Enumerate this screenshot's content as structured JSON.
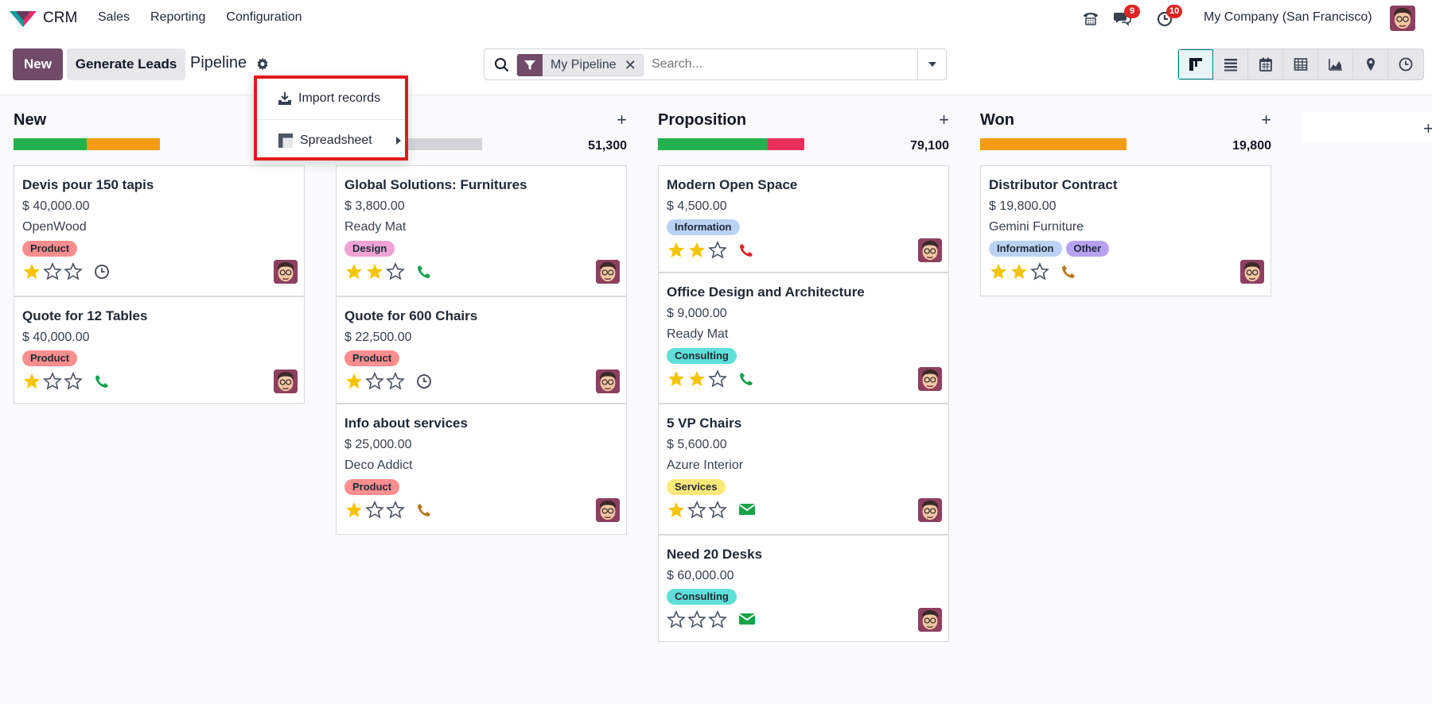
{
  "navbar": {
    "app_name": "CRM",
    "menu": [
      "Sales",
      "Reporting",
      "Configuration"
    ],
    "messages_count": "9",
    "activities_count": "10",
    "company": "My Company (San Francisco)"
  },
  "control": {
    "new_label": "New",
    "generate_label": "Generate Leads",
    "title": "Pipeline",
    "facet_label": "My Pipeline",
    "search_placeholder": "Search..."
  },
  "dropdown": {
    "import_label": "Import records",
    "spreadsheet_label": "Spreadsheet"
  },
  "columns": [
    {
      "title": "New",
      "sum": "",
      "progress": [
        {
          "color": "#22b14c",
          "pct": 0.5
        },
        {
          "color": "#f39c12",
          "pct": 0.5
        }
      ],
      "cards": [
        {
          "title": "Devis pour 150 tapis",
          "amount": "$ 40,000.00",
          "partner": "OpenWood",
          "tags": [
            {
              "label": "Product",
              "color": "#ff8e8e"
            }
          ],
          "stars": 1,
          "activity": "clock"
        },
        {
          "title": "Quote for 12 Tables",
          "amount": "$ 40,000.00",
          "partner": "",
          "tags": [
            {
              "label": "Product",
              "color": "#ff8e8e"
            }
          ],
          "stars": 1,
          "activity": "phone-green"
        }
      ]
    },
    {
      "title": "",
      "sum": "51,300",
      "progress": [
        {
          "color": "#f39c12",
          "pct": 0.15
        },
        {
          "color": "#d1d5db",
          "pct": 0.85
        }
      ],
      "cards": [
        {
          "title": "Global Solutions: Furnitures",
          "amount": "$ 3,800.00",
          "partner": "Ready Mat",
          "tags": [
            {
              "label": "Design",
              "color": "#f0a3d4"
            }
          ],
          "stars": 2,
          "activity": "phone-green"
        },
        {
          "title": "Quote for 600 Chairs",
          "amount": "$ 22,500.00",
          "partner": "",
          "tags": [
            {
              "label": "Product",
              "color": "#ff8e8e"
            }
          ],
          "stars": 1,
          "activity": "clock"
        },
        {
          "title": "Info about services",
          "amount": "$ 25,000.00",
          "partner": "Deco Addict",
          "tags": [
            {
              "label": "Product",
              "color": "#ff8e8e"
            }
          ],
          "stars": 1,
          "activity": "phone-orange"
        }
      ]
    },
    {
      "title": "Proposition",
      "sum": "79,100",
      "progress": [
        {
          "color": "#22b14c",
          "pct": 0.75
        },
        {
          "color": "#e8305a",
          "pct": 0.25
        }
      ],
      "cards": [
        {
          "title": "Modern Open Space",
          "amount": "$ 4,500.00",
          "partner": "",
          "tags": [
            {
              "label": "Information",
              "color": "#bcd2f5"
            }
          ],
          "stars": 2,
          "activity": "phone-red"
        },
        {
          "title": "Office Design and Architecture",
          "amount": "$ 9,000.00",
          "partner": "Ready Mat",
          "tags": [
            {
              "label": "Consulting",
              "color": "#5ee0d8"
            }
          ],
          "stars": 2,
          "activity": "phone-green"
        },
        {
          "title": "5 VP Chairs",
          "amount": "$ 5,600.00",
          "partner": "Azure Interior",
          "tags": [
            {
              "label": "Services",
              "color": "#ffe97a"
            }
          ],
          "stars": 1,
          "activity": "email"
        },
        {
          "title": "Need 20 Desks",
          "amount": "$ 60,000.00",
          "partner": "",
          "tags": [
            {
              "label": "Consulting",
              "color": "#5ee0d8"
            }
          ],
          "stars": 0,
          "activity": "email"
        }
      ]
    },
    {
      "title": "Won",
      "sum": "19,800",
      "progress": [
        {
          "color": "#f39c12",
          "pct": 1.0
        }
      ],
      "cards": [
        {
          "title": "Distributor Contract",
          "amount": "$ 19,800.00",
          "partner": "Gemini Furniture",
          "tags": [
            {
              "label": "Information",
              "color": "#bcd2f5"
            },
            {
              "label": "Other",
              "color": "#b7a2f2"
            }
          ],
          "stars": 2,
          "activity": "phone-orange"
        }
      ]
    }
  ]
}
